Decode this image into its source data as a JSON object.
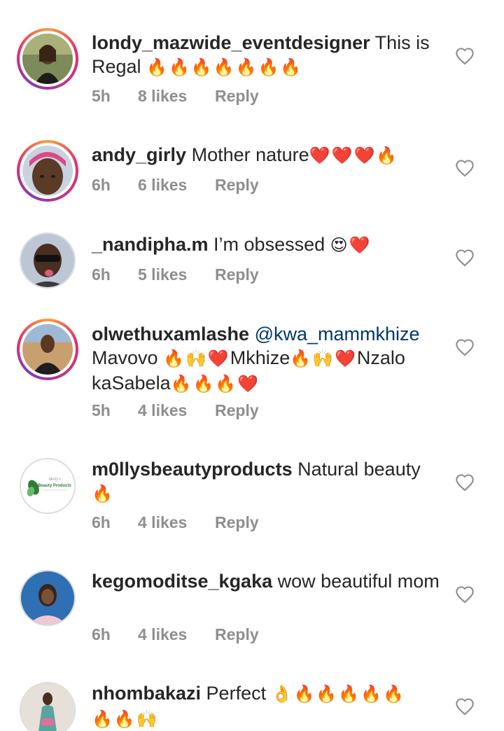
{
  "comments": [
    {
      "username": "londy_mazwide_eventdesigner",
      "text": "This is Regal",
      "emoji": "🔥🔥🔥🔥🔥🔥🔥",
      "time": "5h",
      "likes": "8 likes",
      "reply": "Reply",
      "avatar": "portrait-woman-dark-dress"
    },
    {
      "username": "andy_girly",
      "text": "Mother nature",
      "emoji": "❤️❤️❤️🔥",
      "time": "6h",
      "likes": "6 likes",
      "reply": "Reply",
      "avatar": "portrait-woman-headwrap"
    },
    {
      "username": "_nandipha.m",
      "text": "I’m obsessed",
      "emoji": "😍❤️",
      "time": "6h",
      "likes": "5 likes",
      "reply": "Reply",
      "avatar": "portrait-sunglasses"
    },
    {
      "username": "olwethuxamlashe",
      "mention": "@kwa_mammkhize",
      "text_parts": [
        "Mavovo",
        "🔥🙌❤️",
        "Mkhize",
        "🔥🙌❤️",
        "Nzalo",
        "kaSabela",
        "🔥🔥🔥❤️"
      ],
      "time": "5h",
      "likes": "4 likes",
      "reply": "Reply",
      "avatar": "portrait-man-outdoor"
    },
    {
      "username": "m0llysbeautyproducts",
      "text": "Natural beauty",
      "emoji": "🔥",
      "time": "6h",
      "likes": "4 likes",
      "reply": "Reply",
      "avatar": "logo-mollys-beauty",
      "logo_text": "Molly's Beauty Products"
    },
    {
      "username": "kegomoditse_kgaka",
      "text": "wow beautiful mom",
      "time": "6h",
      "likes": "4 likes",
      "reply": "Reply",
      "avatar": "portrait-woman-pink"
    },
    {
      "username": "nhombakazi",
      "text": "Perfect",
      "emoji": "👌🔥🔥🔥🔥🔥",
      "emoji2": "🔥🔥🙌",
      "avatar": "portrait-woman-long-dress"
    }
  ],
  "colors": {
    "username": "#262626",
    "meta": "#8e8e8e",
    "mention": "#00376b",
    "story_ring": "#e1306c"
  }
}
